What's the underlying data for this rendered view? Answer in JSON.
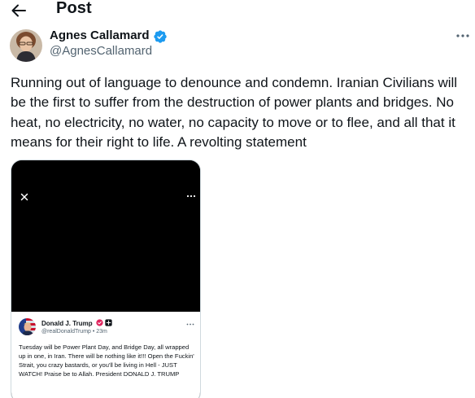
{
  "header": {
    "title": "Post"
  },
  "author": {
    "name": "Agnes Callamard",
    "handle": "@AgnesCallamard",
    "verified_color": "#1d9bf0"
  },
  "post": {
    "text": "Running out of language to denounce and condemn. Iranian Civilians will be the first to suffer from the destruction of power plants and bridges. No heat, no electricity, no water, no capacity to move or to flee, and all that it means for their right to life. A revolting statement"
  },
  "embedded_screenshot": {
    "author_name": "Donald J. Trump",
    "handle_time": "@realDonaldTrump • 23m",
    "text": "Tuesday will be Power Plant Day, and Bridge Day, all wrapped up in one, in Iran. There will be nothing like it!!! Open the Fuckin' Strait, you crazy bastards, or you'll be living in Hell - JUST WATCH! Praise be to Allah. President DONALD J. TRUMP"
  },
  "icons": {
    "back": "arrow-left-icon",
    "more": "more-horizontal-icon",
    "verified": "verified-badge-icon",
    "close": "close-icon"
  }
}
